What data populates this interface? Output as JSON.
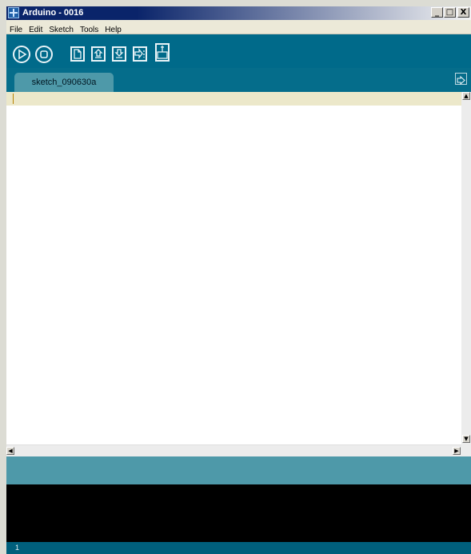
{
  "window": {
    "title": "Arduino - 0016",
    "controls": {
      "minimize": "_",
      "maximize": "□",
      "close": "X"
    }
  },
  "menu": [
    "File",
    "Edit",
    "Sketch",
    "Tools",
    "Help"
  ],
  "toolbar": {
    "buttons": [
      {
        "name": "verify",
        "icon": "play-icon"
      },
      {
        "name": "stop",
        "icon": "stop-icon"
      },
      {
        "name": "new",
        "icon": "new-icon"
      },
      {
        "name": "open",
        "icon": "open-icon"
      },
      {
        "name": "save",
        "icon": "save-icon"
      },
      {
        "name": "upload",
        "icon": "upload-icon"
      },
      {
        "name": "serial-monitor",
        "icon": "serial-monitor-icon"
      }
    ]
  },
  "tabs": [
    {
      "label": "sketch_090630a",
      "active": true
    }
  ],
  "editor": {
    "content": ""
  },
  "console": {
    "text": ""
  },
  "status": {
    "line_number": "1"
  },
  "colors": {
    "toolbar": "#006a8a",
    "tab_active": "#4e99a9",
    "editor_line_highlight": "#ece8ca",
    "console": "#000000",
    "statusbar": "#005f7c"
  }
}
